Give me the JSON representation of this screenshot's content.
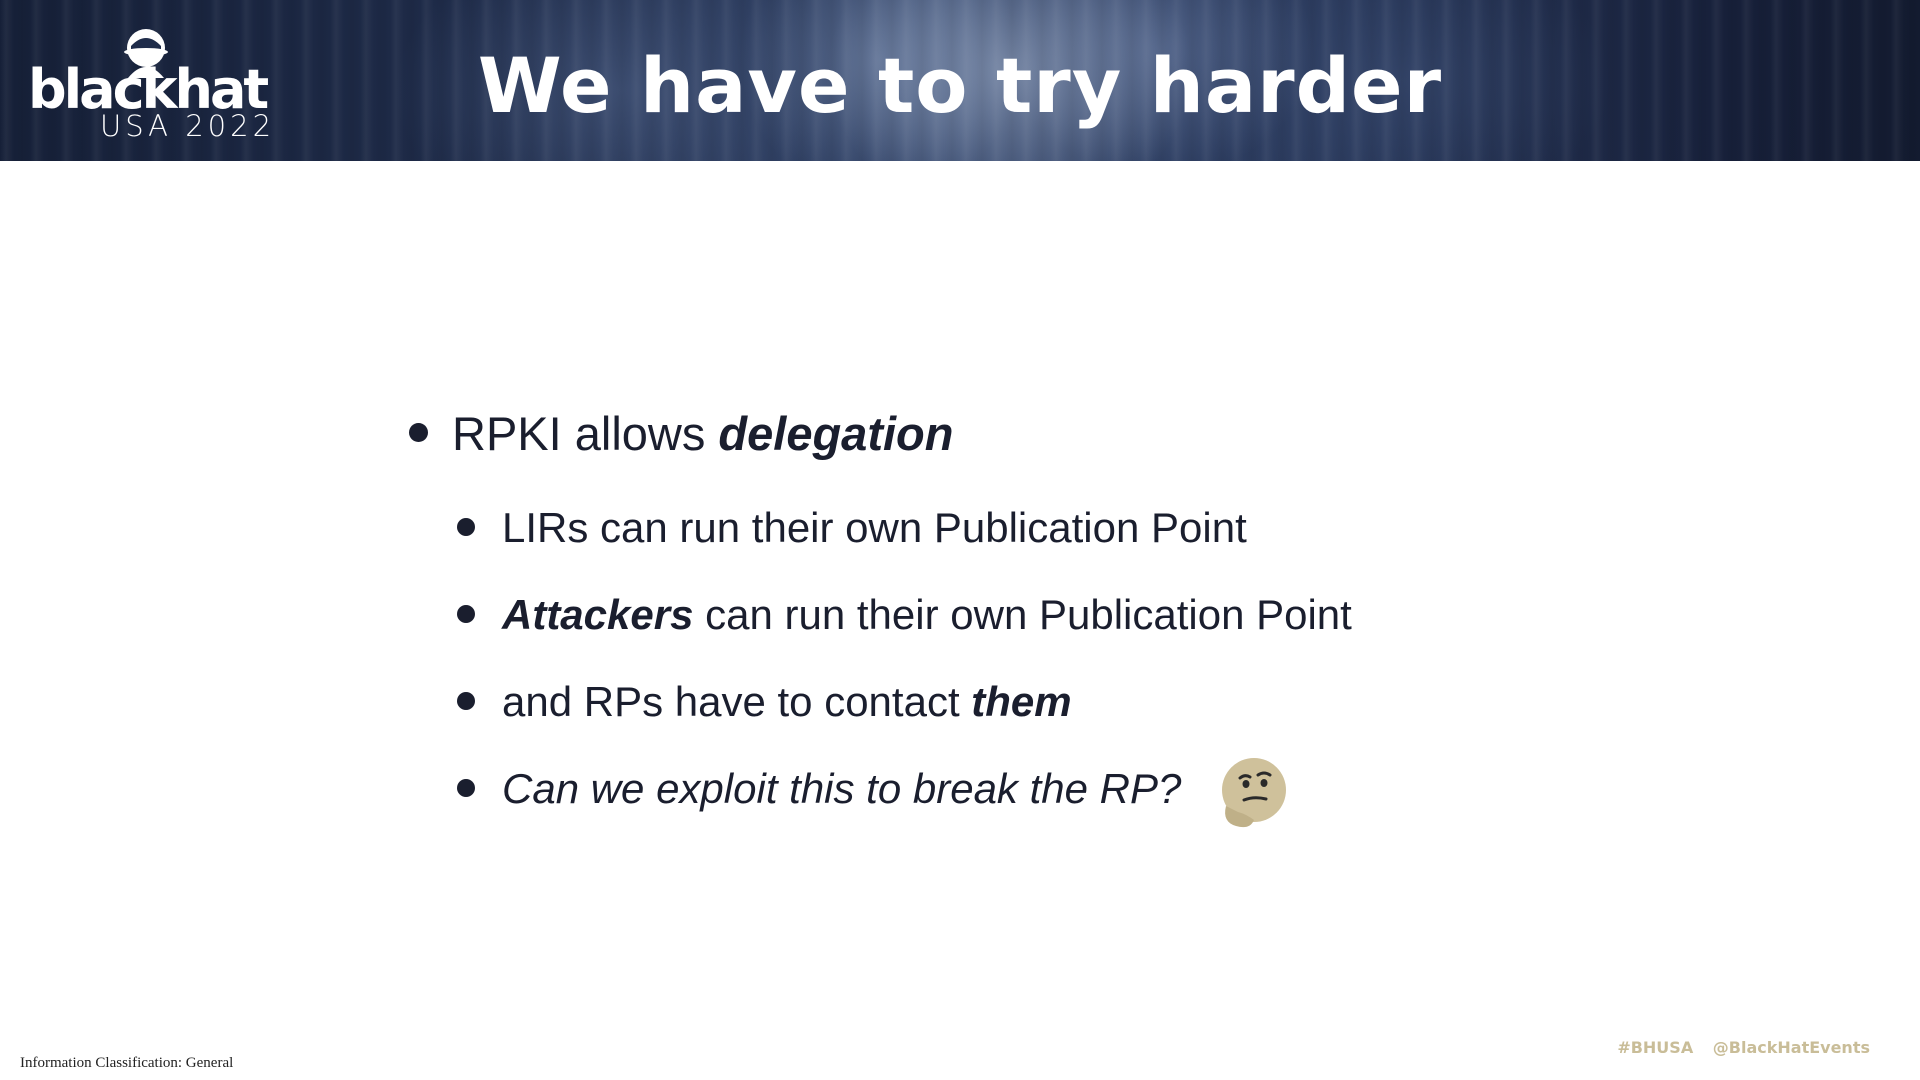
{
  "header": {
    "logo": {
      "wordmark": "blackhat",
      "event": "USA 2022"
    },
    "title": "We have to try harder",
    "colors": {
      "band_dark": "#162038",
      "band_light": "#34466b",
      "title_text": "#ffffff"
    }
  },
  "bullets": {
    "level1": {
      "prefix": "RPKI allows ",
      "emphasis": "delegation"
    },
    "level2": [
      {
        "prefix": "",
        "emphasis": "",
        "text": "LIRs can run their own Publication Point"
      },
      {
        "prefix": "",
        "emphasis": "Attackers",
        "text": " can run their own Publication Point"
      },
      {
        "prefix": "and RPs have to contact ",
        "emphasis": "them",
        "text": ""
      },
      {
        "italic_text": "Can we exploit this to break the RP?",
        "icon": "thinking-face-icon"
      }
    ]
  },
  "footer": {
    "classification": "Information Classification: General",
    "hashtag": "#BHUSA",
    "handle": "@BlackHatEvents",
    "accent_color": "#c9bd98"
  }
}
